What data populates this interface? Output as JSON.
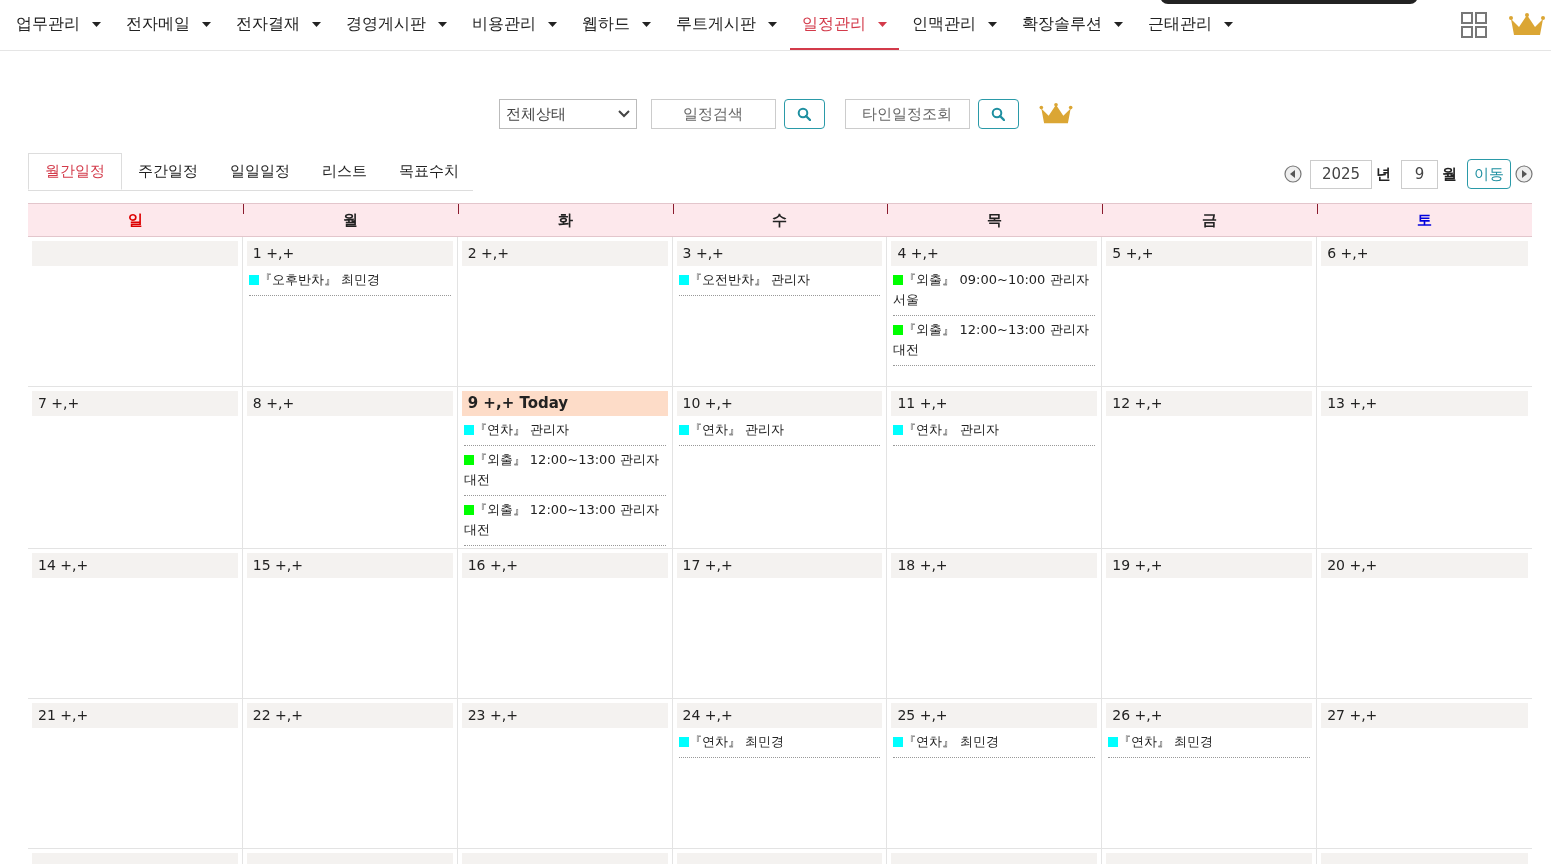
{
  "nav": {
    "items": [
      {
        "label": "업무관리",
        "selected": false
      },
      {
        "label": "전자메일",
        "selected": false
      },
      {
        "label": "전자결재",
        "selected": false
      },
      {
        "label": "경영게시판",
        "selected": false
      },
      {
        "label": "비용관리",
        "selected": false
      },
      {
        "label": "웹하드",
        "selected": false
      },
      {
        "label": "루트게시판",
        "selected": false
      },
      {
        "label": "일정관리",
        "selected": true
      },
      {
        "label": "인맥관리",
        "selected": false
      },
      {
        "label": "확장솔루션",
        "selected": false
      },
      {
        "label": "근태관리",
        "selected": false
      }
    ]
  },
  "search": {
    "status_select": "전체상태",
    "schedule_placeholder": "일정검색",
    "others_placeholder": "타인일정조회"
  },
  "tabs": [
    {
      "label": "월간일정",
      "selected": true
    },
    {
      "label": "주간일정",
      "selected": false
    },
    {
      "label": "일일일정",
      "selected": false
    },
    {
      "label": "리스트",
      "selected": false
    },
    {
      "label": "목표수치",
      "selected": false
    }
  ],
  "period": {
    "year": "2025",
    "year_unit": "년",
    "month": "9",
    "month_unit": "월",
    "go": "이동"
  },
  "weekdays": [
    {
      "label": "일",
      "color": "#dd0000"
    },
    {
      "label": "월",
      "color": "#222222"
    },
    {
      "label": "화",
      "color": "#222222"
    },
    {
      "label": "수",
      "color": "#222222"
    },
    {
      "label": "목",
      "color": "#222222"
    },
    {
      "label": "금",
      "color": "#222222"
    },
    {
      "label": "토",
      "color": "#0000dd"
    }
  ],
  "weeks": [
    [
      {
        "today": false
      },
      {
        "label": "1 +,+",
        "today": false,
        "events": [
          {
            "color": "#00ffff",
            "text": "『오후반차』 최민경"
          }
        ]
      },
      {
        "label": "2 +,+",
        "today": false
      },
      {
        "label": "3 +,+",
        "today": false,
        "events": [
          {
            "color": "#00ffff",
            "text": "『오전반차』 관리자"
          }
        ]
      },
      {
        "label": "4 +,+",
        "today": false,
        "events": [
          {
            "color": "#00ff00",
            "text": "『외출』 09:00~10:00 관리자 서울"
          },
          {
            "color": "#00ff00",
            "text": "『외출』 12:00~13:00 관리자 대전"
          }
        ]
      },
      {
        "label": "5 +,+",
        "today": false
      },
      {
        "label": "6 +,+",
        "today": false
      }
    ],
    [
      {
        "label": "7 +,+",
        "today": false
      },
      {
        "label": "8 +,+",
        "today": false
      },
      {
        "label": "9 +,+ Today",
        "today": true,
        "events": [
          {
            "color": "#00ffff",
            "text": "『연차』 관리자"
          },
          {
            "color": "#00ff00",
            "text": "『외출』 12:00~13:00 관리자 대전"
          },
          {
            "color": "#00ff00",
            "text": "『외출』 12:00~13:00 관리자 대전"
          }
        ]
      },
      {
        "label": "10 +,+",
        "today": false,
        "events": [
          {
            "color": "#00ffff",
            "text": "『연차』 관리자"
          }
        ]
      },
      {
        "label": "11 +,+",
        "today": false,
        "events": [
          {
            "color": "#00ffff",
            "text": "『연차』 관리자"
          }
        ]
      },
      {
        "label": "12 +,+",
        "today": false
      },
      {
        "label": "13 +,+",
        "today": false
      }
    ],
    [
      {
        "label": "14 +,+",
        "today": false
      },
      {
        "label": "15 +,+",
        "today": false
      },
      {
        "label": "16 +,+",
        "today": false
      },
      {
        "label": "17 +,+",
        "today": false
      },
      {
        "label": "18 +,+",
        "today": false
      },
      {
        "label": "19 +,+",
        "today": false
      },
      {
        "label": "20 +,+",
        "today": false
      }
    ],
    [
      {
        "label": "21 +,+",
        "today": false
      },
      {
        "label": "22 +,+",
        "today": false
      },
      {
        "label": "23 +,+",
        "today": false
      },
      {
        "label": "24 +,+",
        "today": false,
        "events": [
          {
            "color": "#00ffff",
            "text": "『연차』 최민경"
          }
        ]
      },
      {
        "label": "25 +,+",
        "today": false,
        "events": [
          {
            "color": "#00ffff",
            "text": "『연차』 최민경"
          }
        ]
      },
      {
        "label": "26 +,+",
        "today": false,
        "events": [
          {
            "color": "#00ffff",
            "text": "『연차』 최민경"
          }
        ]
      },
      {
        "label": "27 +,+",
        "today": false
      }
    ],
    [
      {
        "today": false
      },
      {
        "today": false
      },
      {
        "today": false
      },
      {
        "today": false
      },
      {
        "today": false
      },
      {
        "today": false
      },
      {
        "today": false
      }
    ]
  ]
}
